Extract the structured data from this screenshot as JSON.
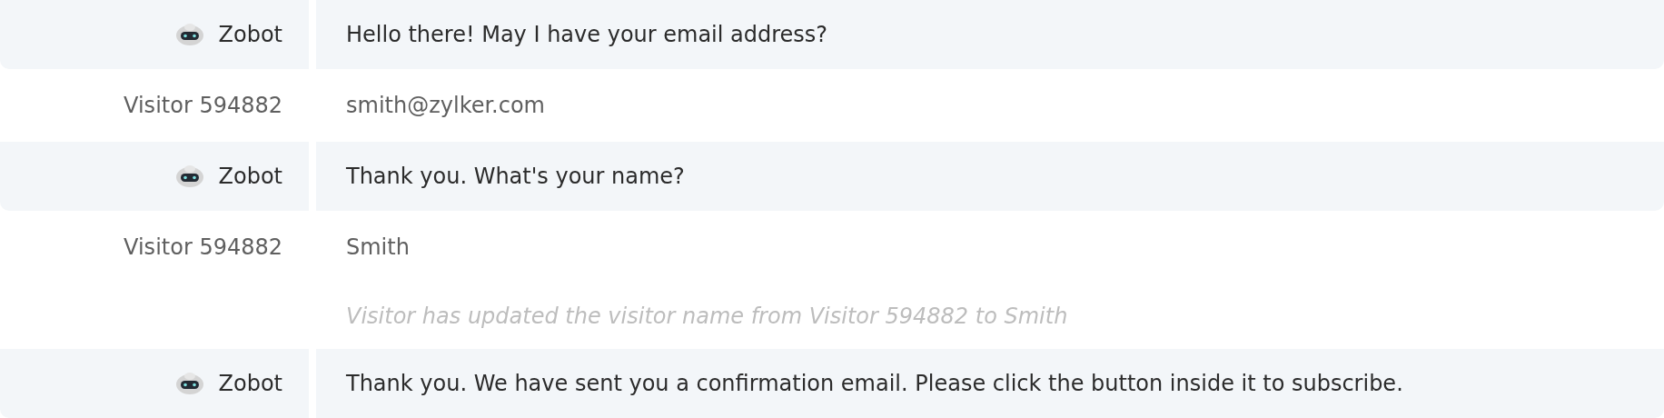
{
  "messages": [
    {
      "kind": "bot",
      "sender": "Zobot",
      "text": "Hello there! May I have your email address?"
    },
    {
      "kind": "visitor",
      "sender": "Visitor 594882",
      "text": "smith@zylker.com"
    },
    {
      "kind": "bot",
      "sender": "Zobot",
      "text": "Thank you. What's your name?"
    },
    {
      "kind": "visitor",
      "sender": "Visitor 594882",
      "text": "Smith"
    },
    {
      "kind": "note",
      "text": "Visitor has updated the visitor name from Visitor 594882 to Smith"
    },
    {
      "kind": "bot",
      "sender": "Zobot",
      "text": "Thank you. We have sent you a confirmation email. Please click the button inside it to subscribe."
    }
  ]
}
